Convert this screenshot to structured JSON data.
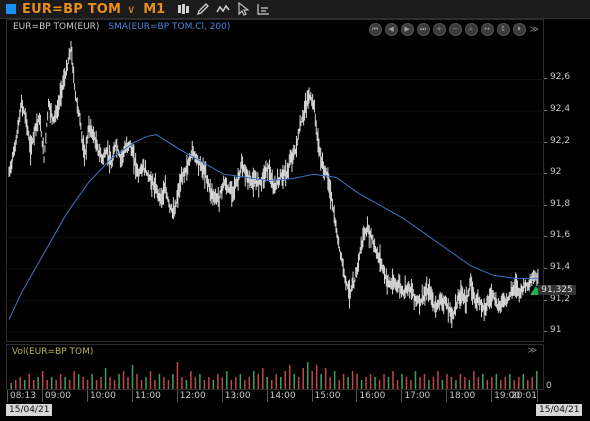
{
  "toolbar": {
    "symbol": "EUR=BP TOM",
    "timeframe": "M1",
    "tools": [
      {
        "name": "candlestick-chart-icon"
      },
      {
        "name": "draw-pencil-icon"
      },
      {
        "name": "line-style-icon"
      },
      {
        "name": "cursor-pointer-icon"
      },
      {
        "name": "indicator-options-icon"
      }
    ]
  },
  "legend": {
    "symbol": "EUR=BP TOM(EUR)",
    "sma": "SMA(EUR=BP TOM.Cl, 200)"
  },
  "nav_buttons": [
    {
      "name": "scroll-start-button",
      "glyph": "⏮"
    },
    {
      "name": "scroll-left-button",
      "glyph": "◀"
    },
    {
      "name": "scroll-right-button",
      "glyph": "▶"
    },
    {
      "name": "scroll-end-button",
      "glyph": "⏭"
    },
    {
      "name": "zoom-in-button",
      "glyph": "+"
    },
    {
      "name": "zoom-out-button",
      "glyph": "−"
    },
    {
      "name": "zoom-search-button",
      "glyph": "⌕"
    },
    {
      "name": "pan-horizontal-button",
      "glyph": "↔"
    },
    {
      "name": "pan-vertical-button",
      "glyph": "↕"
    },
    {
      "name": "scroll-forward-button",
      "glyph": "⏵"
    }
  ],
  "price_axis": {
    "ticks": [
      "92,6",
      "92,4",
      "92,2",
      "92",
      "91,8",
      "91,6",
      "91,4",
      "91,2",
      "91"
    ],
    "values": [
      92.6,
      92.4,
      92.2,
      92.0,
      91.8,
      91.6,
      91.4,
      91.2,
      91.0
    ],
    "min": 91.0,
    "max": 92.6
  },
  "last_price": {
    "label": "91,325",
    "value": 91.325,
    "color": "#23b14d"
  },
  "volume": {
    "label": "Vol(EUR=BP TOM)",
    "axis_zero": "0"
  },
  "time_axis": {
    "ticks": [
      "08:13",
      "09:00",
      "10:00",
      "11:00",
      "12:00",
      "13:00",
      "14:00",
      "15:00",
      "16:00",
      "17:00",
      "18:00",
      "19:00",
      "20:01"
    ],
    "times": [
      8.22,
      9,
      10,
      11,
      12,
      13,
      14,
      15,
      16,
      17,
      18,
      19,
      20.02
    ]
  },
  "dates": {
    "start": "15/04/21",
    "end": "15/04/21"
  },
  "colors": {
    "price": "#d9d9d9",
    "sma": "#3f73c8",
    "vol_up": "#3aa55a",
    "vol_down": "#c24848",
    "accent": "#e98e1c"
  },
  "chart_data": {
    "type": "line",
    "x_label": "time",
    "xlim": [
      8.22,
      20.02
    ],
    "ylim": [
      91.0,
      92.6
    ],
    "series": [
      {
        "name": "EUR=BP TOM(EUR)",
        "x": [
          8.22,
          8.3,
          8.4,
          8.5,
          8.6,
          8.7,
          8.8,
          8.9,
          9.0,
          9.1,
          9.2,
          9.3,
          9.4,
          9.5,
          9.6,
          9.7,
          9.8,
          9.9,
          10.0,
          10.1,
          10.2,
          10.3,
          10.4,
          10.5,
          10.6,
          10.7,
          10.8,
          10.9,
          11.0,
          11.1,
          11.2,
          11.3,
          11.4,
          11.5,
          11.6,
          11.7,
          11.8,
          11.9,
          12.0,
          12.1,
          12.2,
          12.3,
          12.4,
          12.5,
          12.6,
          12.7,
          12.8,
          12.9,
          13.0,
          13.1,
          13.2,
          13.3,
          13.4,
          13.5,
          13.6,
          13.7,
          13.8,
          13.9,
          14.0,
          14.1,
          14.2,
          14.3,
          14.4,
          14.5,
          14.6,
          14.7,
          14.8,
          14.9,
          15.0,
          15.1,
          15.2,
          15.3,
          15.4,
          15.5,
          15.6,
          15.7,
          15.8,
          15.9,
          16.0,
          16.1,
          16.2,
          16.3,
          16.4,
          16.5,
          16.6,
          16.7,
          16.8,
          16.9,
          17.0,
          17.1,
          17.2,
          17.3,
          17.4,
          17.5,
          17.6,
          17.7,
          17.8,
          17.9,
          18.0,
          18.1,
          18.2,
          18.3,
          18.4,
          18.5,
          18.6,
          18.7,
          18.8,
          18.9,
          19.0,
          19.1,
          19.2,
          19.3,
          19.4,
          19.5,
          19.6,
          19.7,
          19.8,
          19.9,
          20.02
        ],
        "y": [
          92.0,
          92.1,
          92.25,
          92.45,
          92.35,
          92.15,
          92.3,
          92.35,
          92.1,
          92.45,
          92.35,
          92.4,
          92.55,
          92.65,
          92.8,
          92.5,
          92.35,
          92.1,
          92.3,
          92.25,
          92.15,
          92.1,
          92.15,
          92.05,
          92.2,
          92.1,
          92.15,
          92.2,
          92.1,
          92.0,
          92.05,
          92.0,
          91.95,
          91.9,
          91.85,
          91.9,
          91.8,
          91.75,
          91.9,
          92.0,
          92.05,
          92.15,
          92.1,
          92.05,
          92.0,
          91.9,
          91.85,
          91.85,
          91.95,
          91.9,
          91.9,
          91.95,
          92.05,
          92.0,
          91.95,
          91.95,
          91.95,
          92.0,
          92.05,
          91.9,
          91.95,
          92.0,
          92.0,
          92.1,
          92.15,
          92.3,
          92.4,
          92.5,
          92.45,
          92.2,
          92.05,
          92.0,
          91.85,
          91.65,
          91.5,
          91.35,
          91.25,
          91.3,
          91.45,
          91.6,
          91.65,
          91.6,
          91.5,
          91.45,
          91.35,
          91.3,
          91.3,
          91.3,
          91.25,
          91.3,
          91.25,
          91.2,
          91.2,
          91.25,
          91.25,
          91.15,
          91.2,
          91.2,
          91.15,
          91.1,
          91.2,
          91.25,
          91.2,
          91.3,
          91.2,
          91.2,
          91.15,
          91.2,
          91.25,
          91.15,
          91.2,
          91.2,
          91.25,
          91.3,
          91.25,
          91.3,
          91.3,
          91.35,
          91.35
        ]
      },
      {
        "name": "SMA(EUR=BP TOM.Cl, 200)",
        "x": [
          8.22,
          8.5,
          9.0,
          9.5,
          10.0,
          10.5,
          11.0,
          11.3,
          11.5,
          12.0,
          12.5,
          13.0,
          13.5,
          14.0,
          14.5,
          15.0,
          15.5,
          16.0,
          16.5,
          17.0,
          17.5,
          18.0,
          18.5,
          19.0,
          19.5,
          20.02
        ],
        "y": [
          91.08,
          91.25,
          91.5,
          91.75,
          91.95,
          92.1,
          92.2,
          92.24,
          92.25,
          92.16,
          92.08,
          92.0,
          91.98,
          91.96,
          91.97,
          92.0,
          91.98,
          91.88,
          91.8,
          91.72,
          91.62,
          91.52,
          91.42,
          91.36,
          91.34,
          91.34
        ]
      }
    ],
    "volume_bars": [
      2,
      3,
      4,
      3,
      5,
      3,
      4,
      6,
      3,
      4,
      3,
      5,
      4,
      3,
      6,
      5,
      4,
      3,
      5,
      3,
      4,
      7,
      4,
      3,
      5,
      6,
      4,
      8,
      5,
      3,
      4,
      6,
      3,
      5,
      4,
      3,
      5,
      9,
      4,
      3,
      6,
      4,
      5,
      3,
      4,
      3,
      5,
      4,
      6,
      3,
      4,
      5,
      3,
      4,
      6,
      5,
      7,
      4,
      3,
      5,
      4,
      6,
      8,
      5,
      4,
      7,
      9,
      6,
      8,
      5,
      7,
      4,
      6,
      3,
      5,
      4,
      6,
      5,
      3,
      4,
      5,
      4,
      3,
      5,
      4,
      6,
      3,
      5,
      4,
      3,
      6,
      4,
      5,
      3,
      4,
      6,
      3,
      5,
      4,
      3,
      5,
      4,
      3,
      6,
      4,
      5,
      3,
      4,
      5,
      3,
      4,
      5,
      3,
      4,
      5,
      3,
      4,
      6
    ]
  }
}
